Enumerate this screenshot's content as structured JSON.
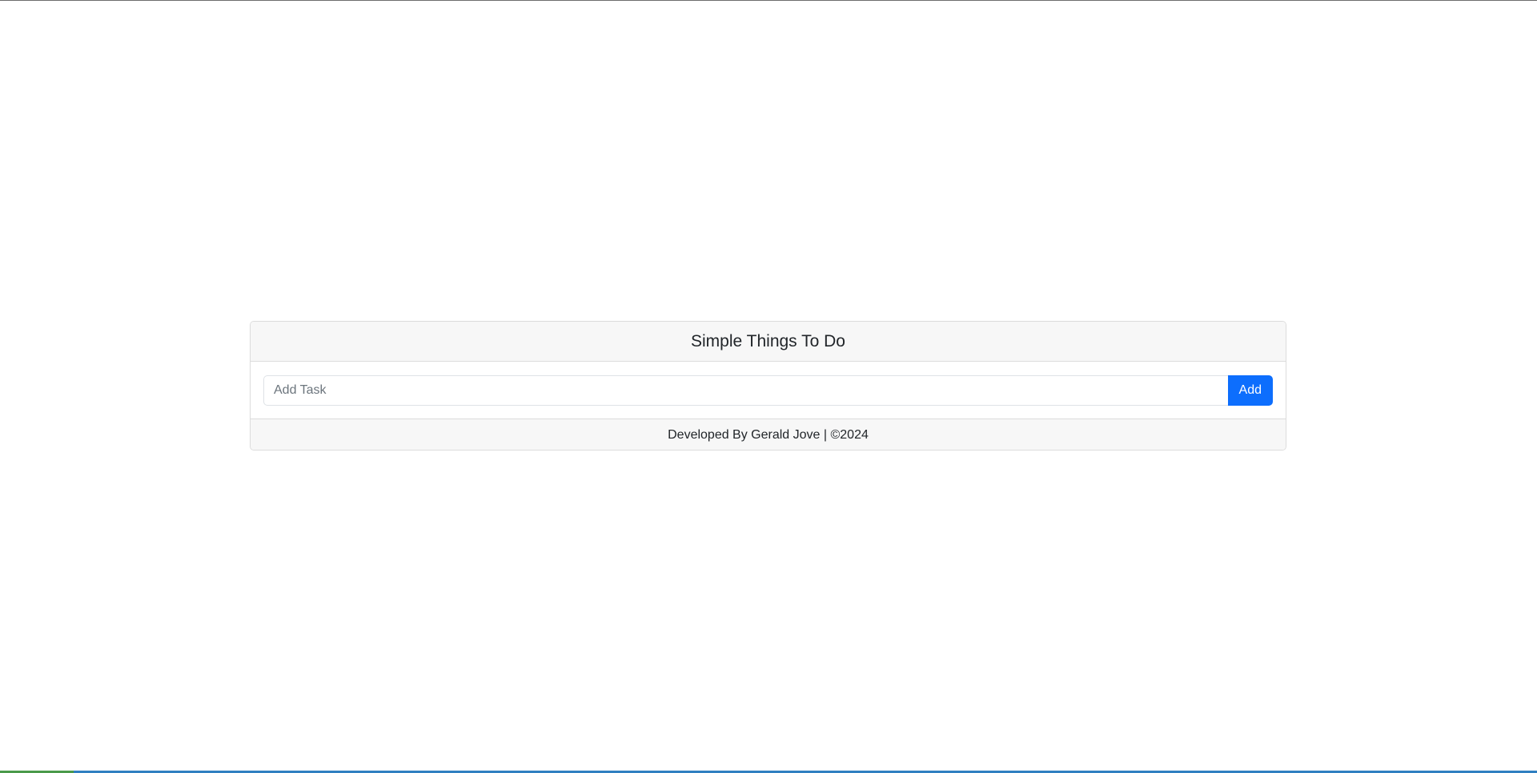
{
  "app": {
    "title": "Simple Things To Do"
  },
  "task_form": {
    "input_value": "",
    "input_placeholder": "Add Task",
    "add_label": "Add"
  },
  "footer": {
    "text": "Developed By Gerald Jove | ©2024"
  },
  "colors": {
    "primary": "#0d6efd",
    "card_header_bg": "#f7f7f7",
    "border": "#dcdcdc"
  }
}
